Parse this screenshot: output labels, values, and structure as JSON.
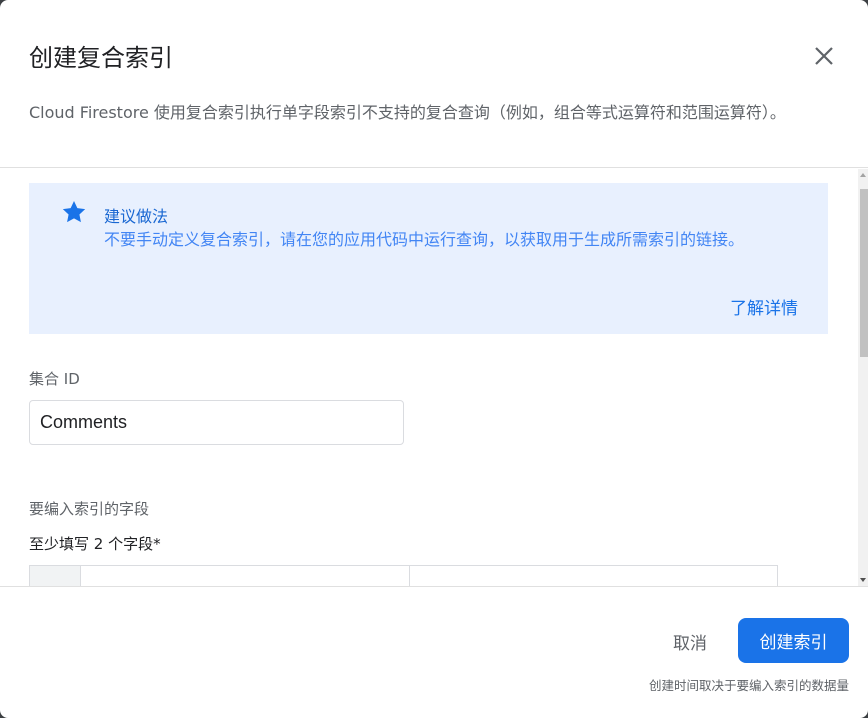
{
  "dialog": {
    "title": "创建复合索引",
    "subtitle": "Cloud Firestore 使用复合索引执行单字段索引不支持的复合查询（例如，组合等式运算符和范围运算符）。",
    "close_icon": "close-icon"
  },
  "tip": {
    "icon": "star-icon",
    "title": "建议做法",
    "text": "不要手动定义复合索引，请在您的应用代码中运行查询，以获取用于生成所需索引的链接。",
    "link": "了解详情"
  },
  "collection": {
    "label": "集合 ID",
    "value": "Comments"
  },
  "fields": {
    "label": "要编入索引的字段",
    "requirement": "至少填写 2 个字段*"
  },
  "footer": {
    "cancel": "取消",
    "create": "创建索引",
    "note": "创建时间取决于要编入索引的数据量"
  },
  "colors": {
    "primary": "#1a73e8",
    "tip_bg": "#e8f0fe",
    "tip_text": "#4285f4"
  }
}
